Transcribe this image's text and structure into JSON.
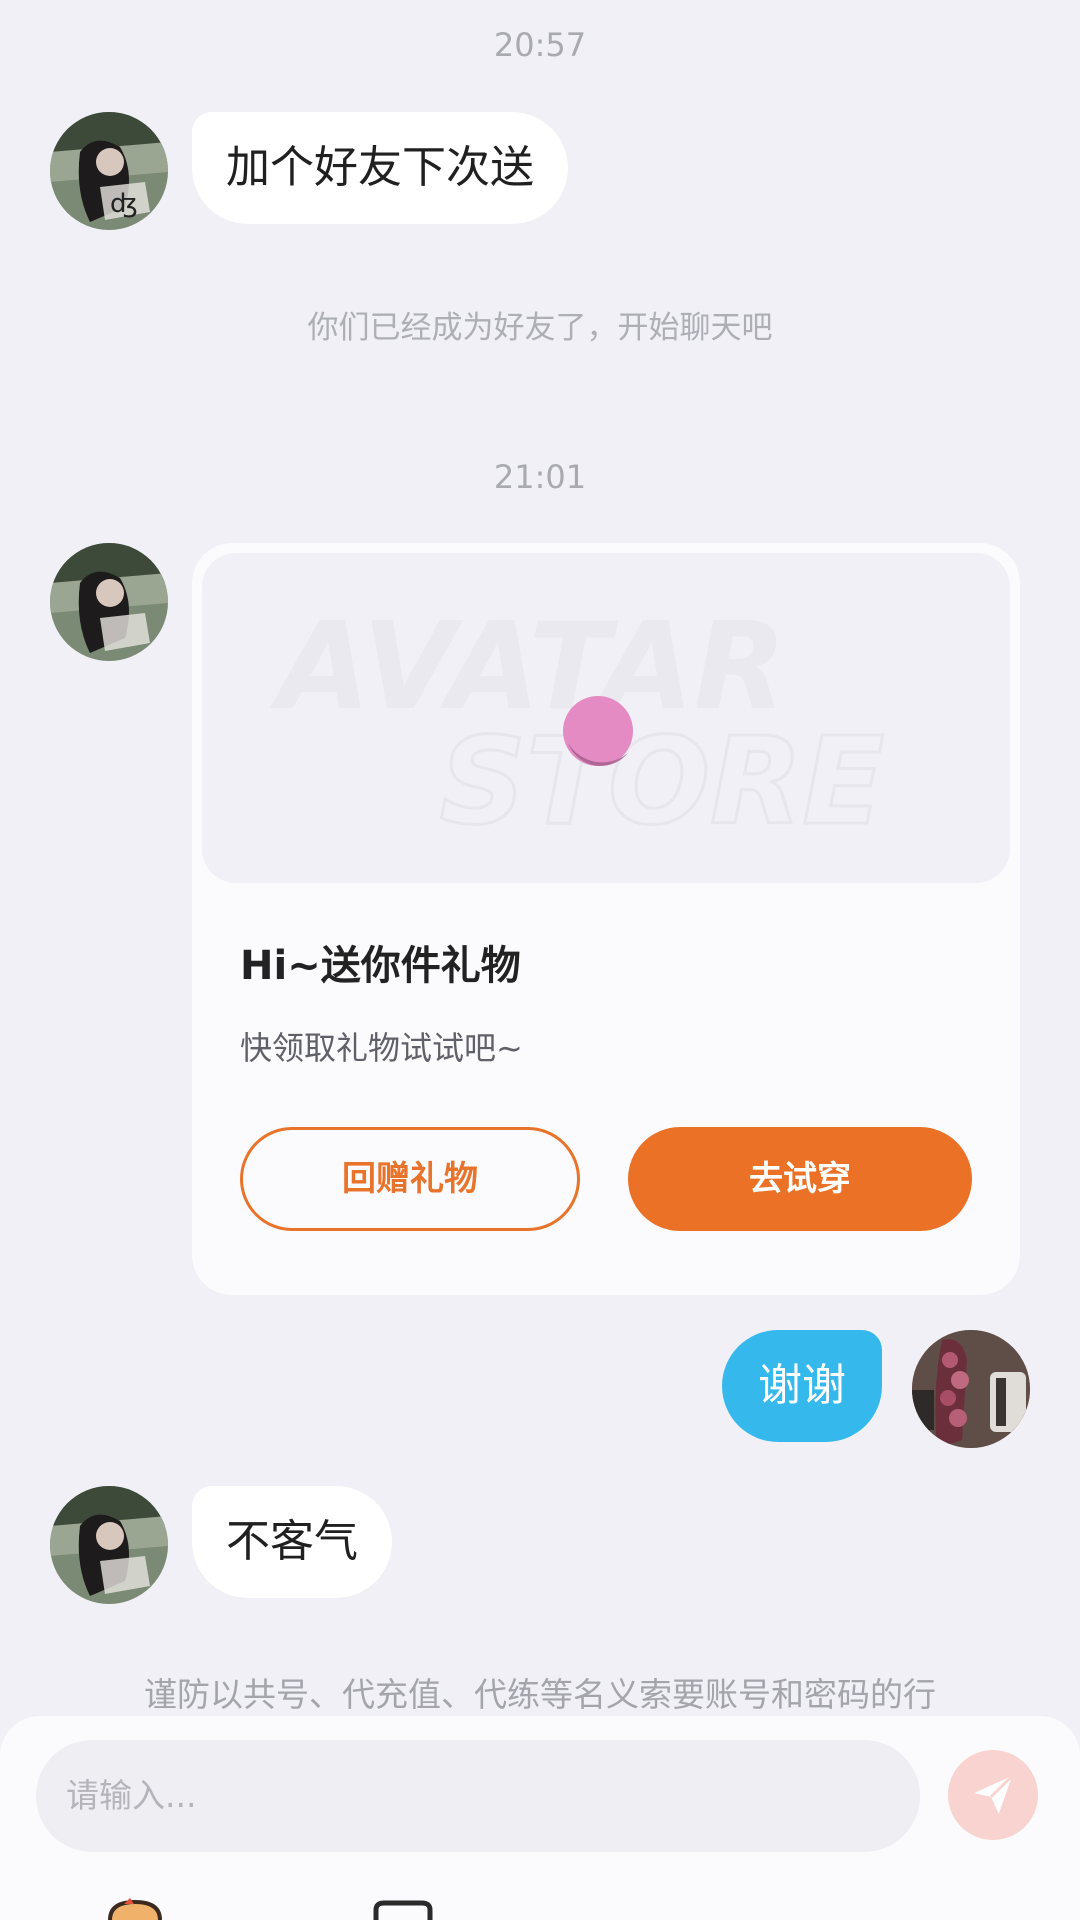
{
  "chat": {
    "time_1": "20:57",
    "msg_1": "加个好友下次送",
    "system_note": "你们已经成为好友了，开始聊天吧",
    "time_2": "21:01",
    "gift_card": {
      "banner_text_line1": "AVATAR",
      "banner_text_line2": "STORE",
      "title": "Hi~送你件礼物",
      "subtitle": "快领取礼物试试吧~",
      "return_gift_label": "回赠礼物",
      "try_on_label": "去试穿"
    },
    "msg_2_self": "谢谢",
    "msg_3": "不客气",
    "warning": "谨防以共号、代充值、代练等名义索要账号和密码的行"
  },
  "composer": {
    "placeholder": "请输入...",
    "send_icon": "paper-plane-icon",
    "toolbar_icons": [
      "sticker-character-icon",
      "image-icon"
    ]
  },
  "colors": {
    "background": "#f0f0f6",
    "self_bubble": "#35b9ec",
    "accent_orange": "#ea7126",
    "send_button": "#f9d3cf"
  }
}
